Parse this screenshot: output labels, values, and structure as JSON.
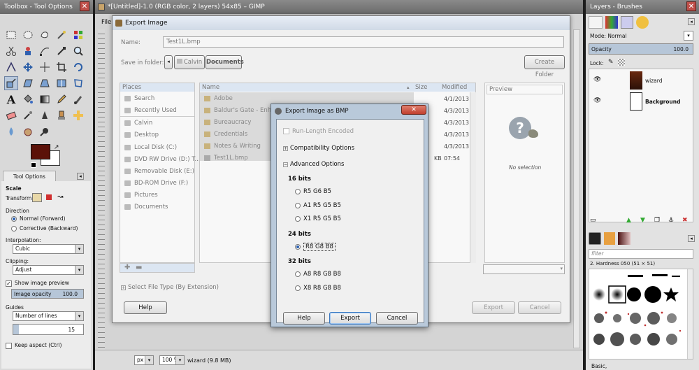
{
  "toolbox": {
    "title": "Toolbox - Tool Options",
    "tool_options_tab": "Tool Options",
    "scale_heading": "Scale",
    "transform_label": "Transform:",
    "direction_label": "Direction",
    "direction_forward": "Normal (Forward)",
    "direction_backward": "Corrective (Backward)",
    "interpolation_label": "Interpolation:",
    "interpolation_value": "Cubic",
    "clipping_label": "Clipping:",
    "clipping_value": "Adjust",
    "show_preview_label": "Show image preview",
    "image_opacity_label": "Image opacity",
    "image_opacity_value": "100.0",
    "guides_label": "Guides",
    "guides_value": "Number of lines",
    "lines_value": "15",
    "keep_aspect_label": "Keep aspect  (Ctrl)",
    "fg_color": "#5b1108",
    "bg_color": "#ffffff"
  },
  "gimp_main": {
    "title": "*[Untitled]-1.0 (RGB color, 2 layers) 54x85 – GIMP",
    "menu_file": "File",
    "unit_value": "px",
    "zoom_value": "100 %",
    "status_text": "wizard (9.8 MB)"
  },
  "export_image": {
    "title": "Export Image",
    "name_label": "Name:",
    "name_value": "Test1L.bmp",
    "save_in_label": "Save in folder:",
    "crumb_calvin": "Calvin",
    "crumb_documents": "Documents",
    "create_folder": "Create Folder",
    "places_header": "Places",
    "places": [
      "Search",
      "Recently Used",
      "Calvin",
      "Desktop",
      "Local Disk (C:)",
      "DVD RW Drive (D:) T...",
      "Removable Disk (E:)",
      "BD-ROM Drive (F:)",
      "Pictures",
      "Documents"
    ],
    "col_name": "Name",
    "col_size": "Size",
    "col_modified": "Modified",
    "files": [
      {
        "name": "Adobe",
        "size": "",
        "modified": "4/1/2013"
      },
      {
        "name": "Baldur's Gate - Enhance",
        "size": "",
        "modified": "4/3/2013"
      },
      {
        "name": "Bureaucracy",
        "size": "",
        "modified": "4/3/2013"
      },
      {
        "name": "Credentials",
        "size": "",
        "modified": "4/3/2013"
      },
      {
        "name": "Notes & Writing",
        "size": "",
        "modified": "4/3/2013"
      },
      {
        "name": "Test1L.bmp",
        "size": "KB",
        "modified": "07:54"
      }
    ],
    "preview_label": "Preview",
    "no_selection": "No selection",
    "select_file_type": "Select File Type (By Extension)",
    "help": "Help",
    "export": "Export",
    "cancel": "Cancel"
  },
  "bmp_dialog": {
    "title": "Export Image as BMP",
    "rle_label": "Run-Length Encoded",
    "compat_label": "Compatibility Options",
    "advanced_label": "Advanced Options",
    "bits16_label": "16 bits",
    "opt_r5g6b5": "R5 G6 B5",
    "opt_a1r5g5b5": "A1 R5 G5 B5",
    "opt_x1r5g5b5": "X1 R5 G5 B5",
    "bits24_label": "24 bits",
    "opt_r8g8b8": "R8 G8 B8",
    "bits32_label": "32 bits",
    "opt_a8r8g8b8": "A8 R8 G8 B8",
    "opt_x8r8g8b8": "X8 R8 G8 B8",
    "help": "Help",
    "export": "Export",
    "cancel": "Cancel"
  },
  "layers": {
    "title": "Layers - Brushes",
    "mode_label": "Mode:",
    "mode_value": "Normal",
    "opacity_label": "Opacity",
    "opacity_value": "100.0",
    "lock_label": "Lock:",
    "layer_wizard": "wizard",
    "layer_background": "Background",
    "filter_placeholder": "filter",
    "brush_name": "2. Hardness 050 (51 × 51)",
    "brush_preset": "Basic,"
  }
}
